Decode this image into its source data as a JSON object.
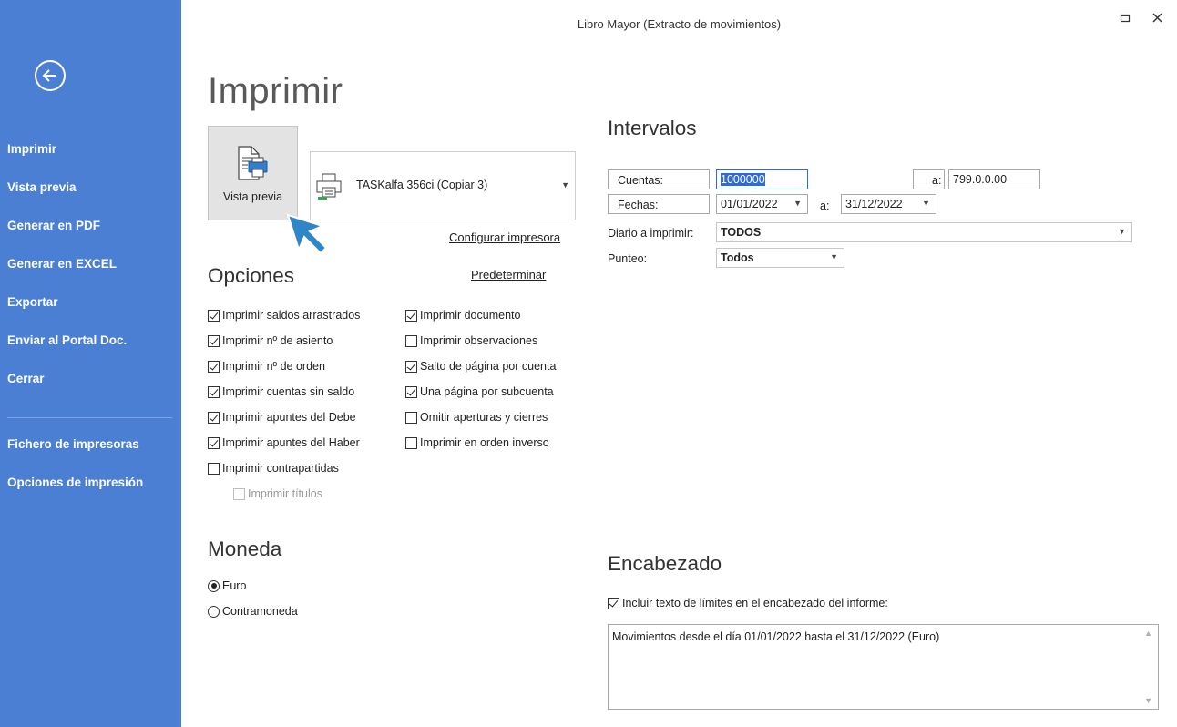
{
  "window": {
    "title": "Libro Mayor (Extracto de movimientos)",
    "maximize_icon": "maximize-icon",
    "close_icon": "close-icon"
  },
  "sidebar": {
    "back_icon": "back-arrow-icon",
    "items": [
      {
        "label": "Imprimir"
      },
      {
        "label": "Vista previa"
      },
      {
        "label": "Generar en PDF"
      },
      {
        "label": "Generar en EXCEL"
      },
      {
        "label": "Exportar"
      },
      {
        "label": "Enviar al Portal Doc."
      },
      {
        "label": "Cerrar"
      },
      {
        "label": "Fichero de impresoras"
      },
      {
        "label": "Opciones de impresión"
      }
    ],
    "color": "#4a7fd4"
  },
  "page": {
    "title": "Imprimir"
  },
  "preview_button": {
    "label": "Vista previa",
    "icon": "print-preview-icon"
  },
  "printer": {
    "name": "TASKalfa 356ci (Copiar 3)",
    "icon": "printer-icon"
  },
  "links": {
    "configure_printer": "Configurar impresora",
    "default": "Predeterminar"
  },
  "options": {
    "heading": "Opciones",
    "left": [
      {
        "label": "Imprimir saldos arrastrados",
        "checked": true
      },
      {
        "label": "Imprimir nº de asiento",
        "checked": true
      },
      {
        "label": "Imprimir nº de orden",
        "checked": true
      },
      {
        "label": "Imprimir cuentas sin saldo",
        "checked": true
      },
      {
        "label": "Imprimir apuntes del Debe",
        "checked": true
      },
      {
        "label": "Imprimir apuntes del Haber",
        "checked": true
      },
      {
        "label": "Imprimir contrapartidas",
        "checked": false
      }
    ],
    "sub": {
      "label": "Imprimir títulos",
      "checked": false,
      "disabled": true
    },
    "right": [
      {
        "label": "Imprimir documento",
        "checked": true
      },
      {
        "label": "Imprimir observaciones",
        "checked": false
      },
      {
        "label": "Salto de página por cuenta",
        "checked": true
      },
      {
        "label": "Una página por subcuenta",
        "checked": true
      },
      {
        "label": "Omitir aperturas y cierres",
        "checked": false
      },
      {
        "label": "Imprimir en orden inverso",
        "checked": false
      }
    ]
  },
  "currency": {
    "heading": "Moneda",
    "options": [
      {
        "label": "Euro",
        "selected": true
      },
      {
        "label": "Contramoneda",
        "selected": false
      }
    ]
  },
  "intervals": {
    "heading": "Intervalos",
    "accounts_label": "Cuentas:",
    "accounts_from": "1000000",
    "to_label": "a:",
    "accounts_to": "799.0.0.00",
    "dates_label": "Fechas:",
    "date_from": "01/01/2022",
    "date_to": "31/12/2022",
    "journal_label": "Diario a imprimir:",
    "journal_value": "TODOS",
    "punteo_label": "Punteo:",
    "punteo_value": "Todos"
  },
  "header_section": {
    "heading": "Encabezado",
    "include_label": "Incluir texto de límites en el encabezado del informe:",
    "include_checked": true,
    "text": "Movimientos desde el día 01/01/2022 hasta el 31/12/2022 (Euro)"
  }
}
